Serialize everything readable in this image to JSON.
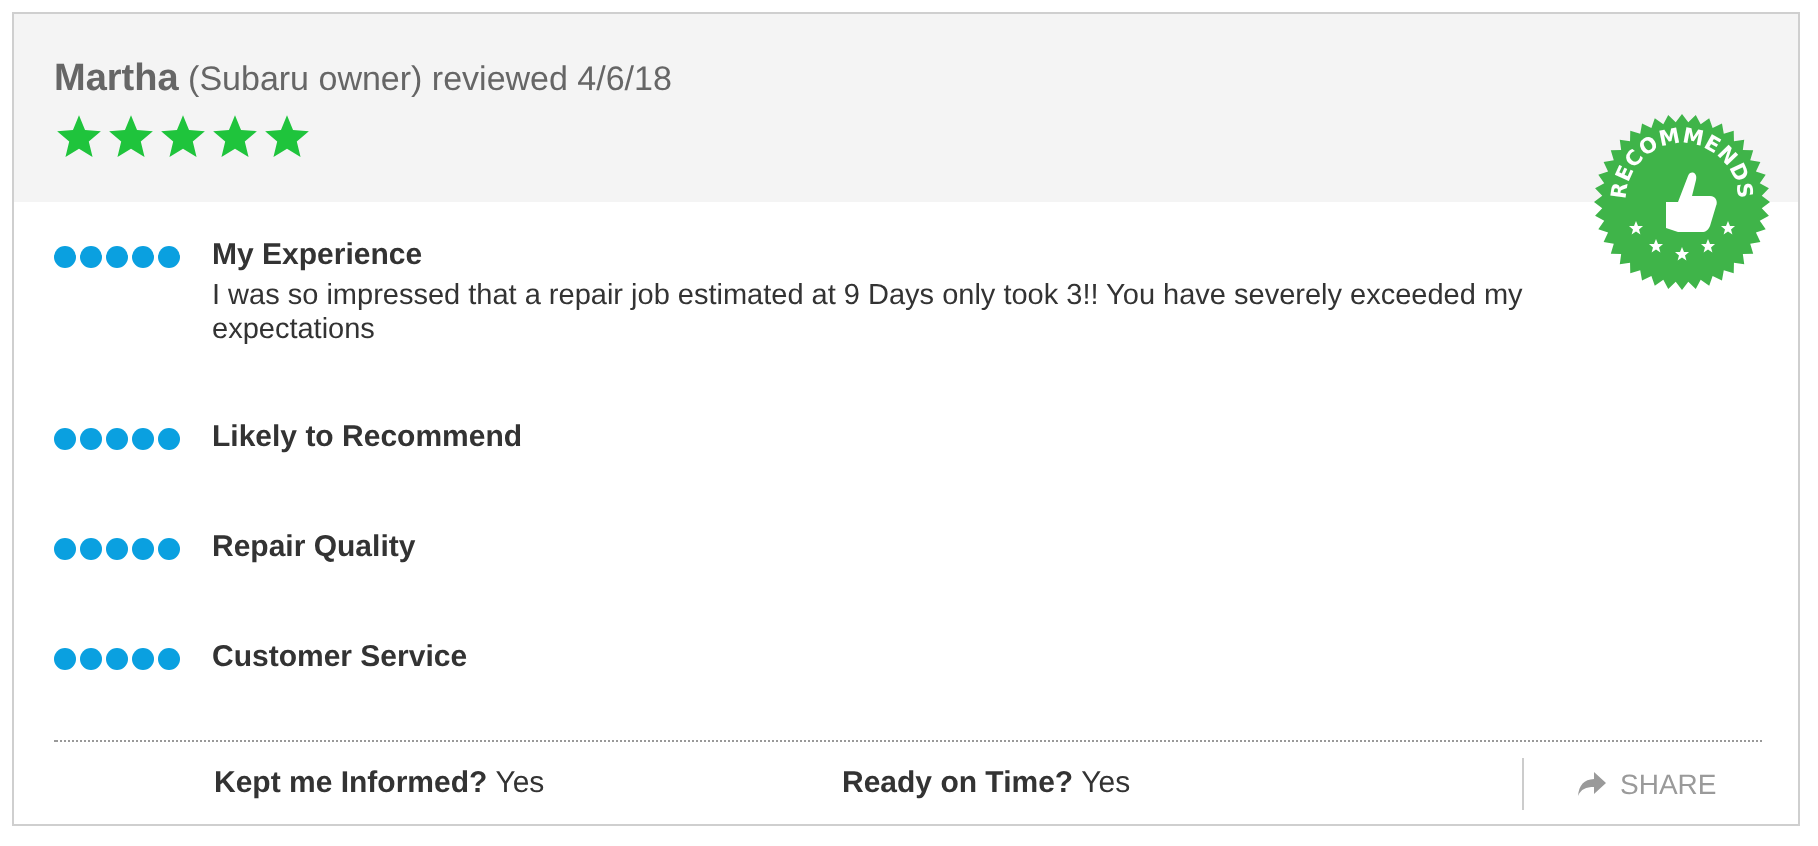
{
  "review": {
    "name": "Martha",
    "meta": "(Subaru owner) reviewed 4/6/18",
    "stars": 5
  },
  "badge": {
    "text": "RECOMMENDS"
  },
  "ratings": [
    {
      "title": "My Experience",
      "stars": 5,
      "comment": "I was so impressed that a repair job estimated at 9 Days only took 3!! You have severely exceeded my expectations"
    },
    {
      "title": "Likely to Recommend",
      "stars": 5
    },
    {
      "title": "Repair Quality",
      "stars": 5
    },
    {
      "title": "Customer Service",
      "stars": 5
    }
  ],
  "footer": [
    {
      "label": "Kept me Informed?",
      "value": "Yes"
    },
    {
      "label": "Ready on Time?",
      "value": "Yes"
    }
  ],
  "share": {
    "label": "SHARE"
  }
}
